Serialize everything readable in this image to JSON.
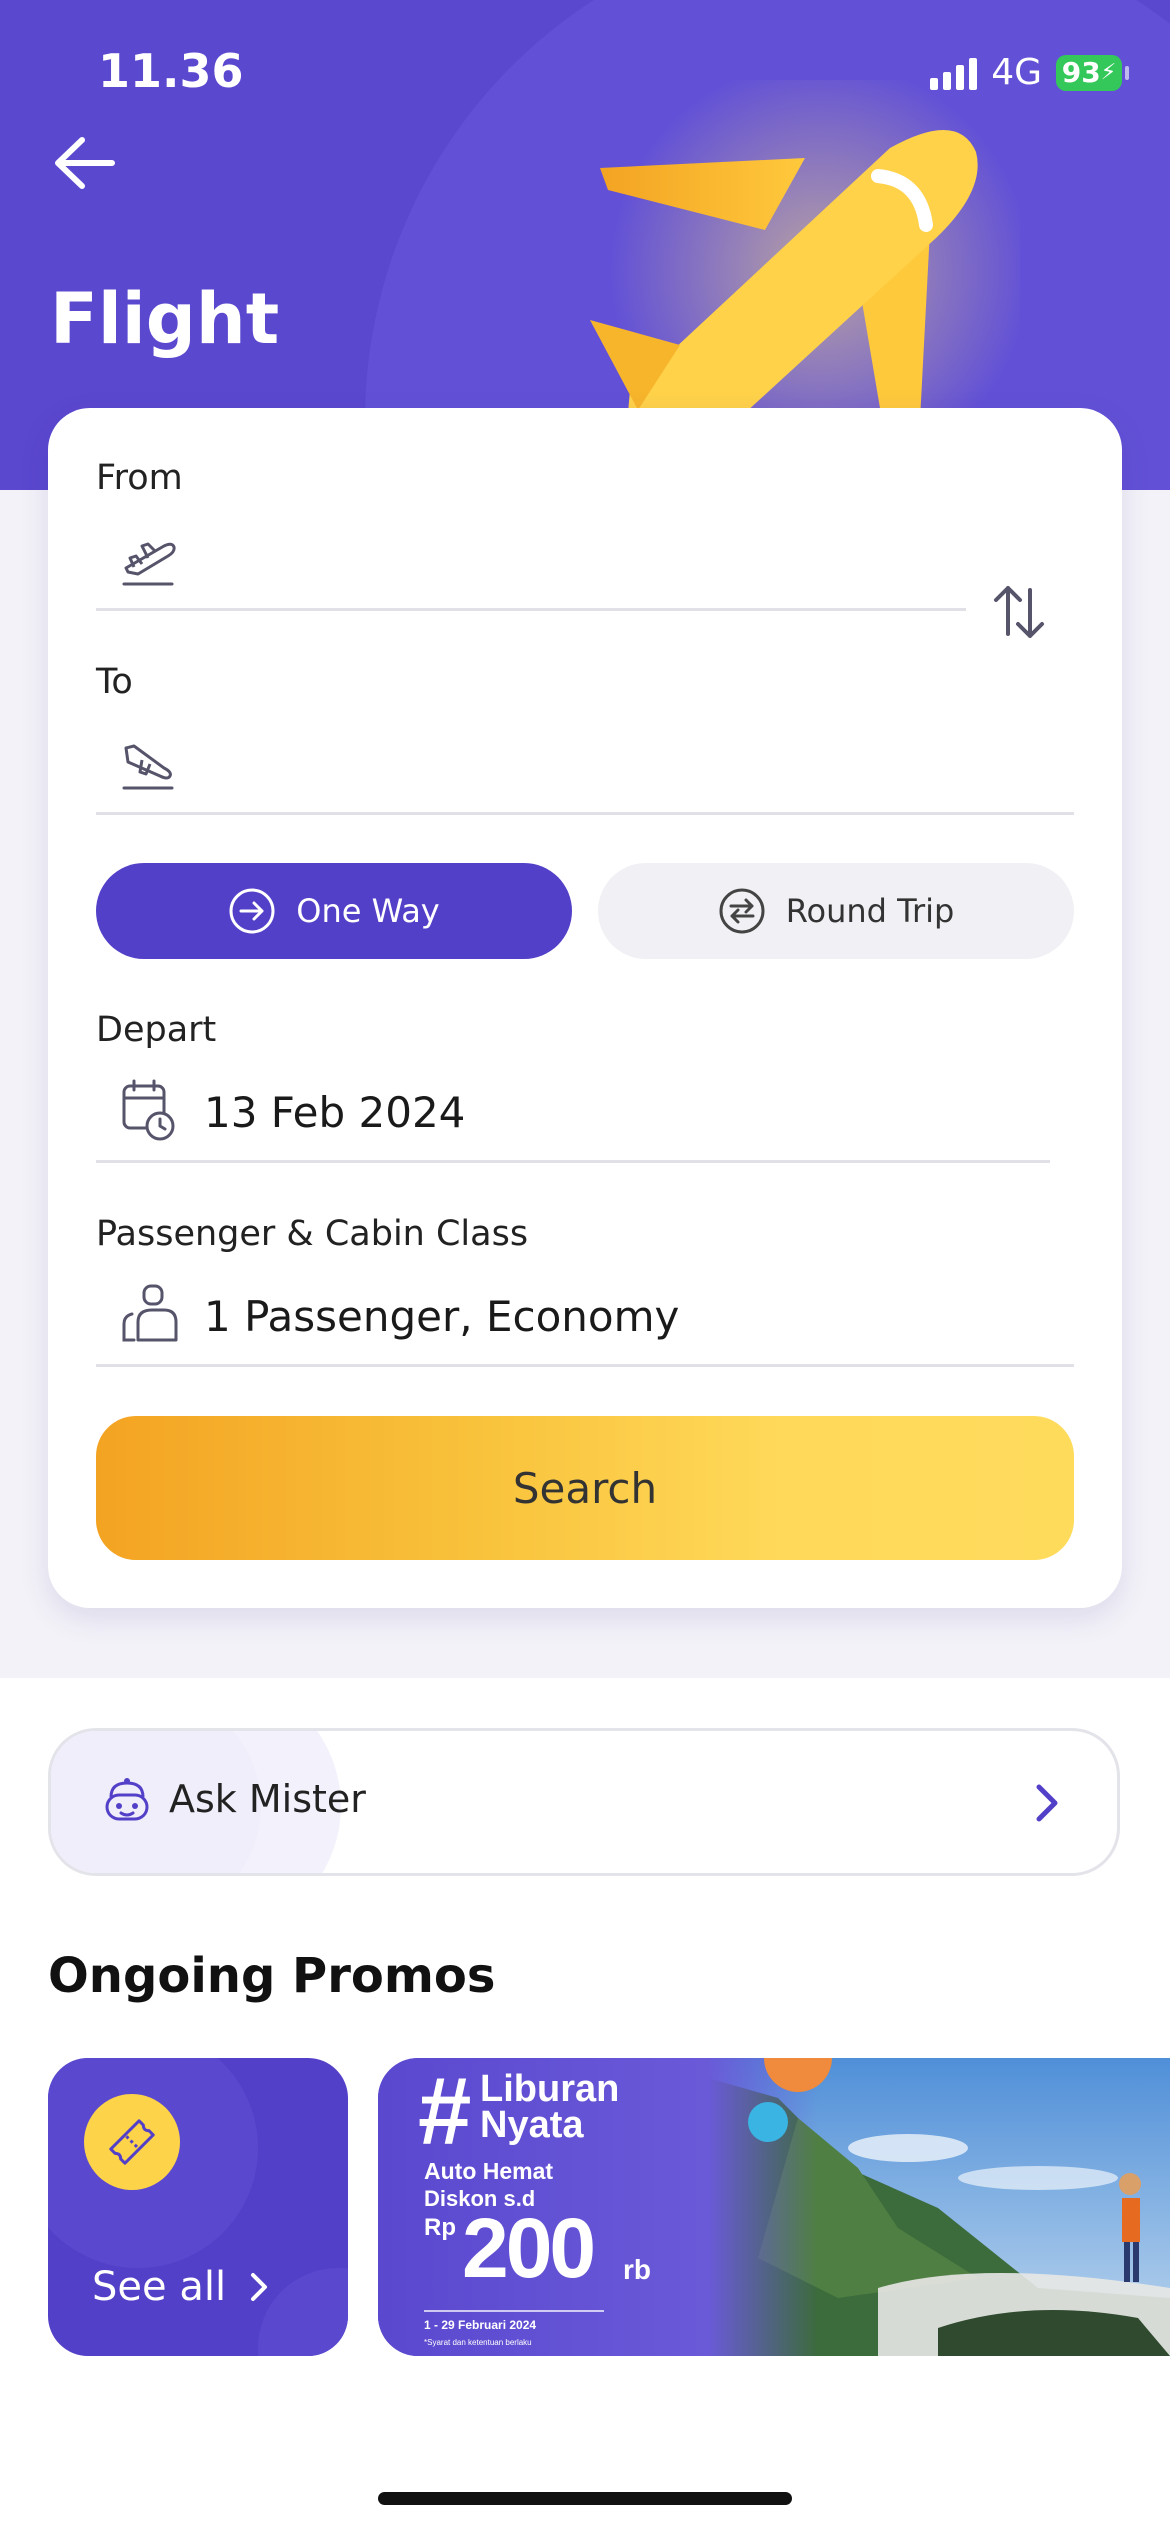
{
  "status_bar": {
    "time": "11.36",
    "network": "4G",
    "battery": "93"
  },
  "header": {
    "title": "Flight"
  },
  "form": {
    "from_label": "From",
    "from_value": "",
    "to_label": "To",
    "to_value": "",
    "trip_types": {
      "one_way": "One Way",
      "round_trip": "Round Trip",
      "selected": "One Way"
    },
    "depart_label": "Depart",
    "depart_value": "13 Feb 2024",
    "passenger_label": "Passenger & Cabin Class",
    "passenger_value": "1 Passenger, Economy",
    "search_label": "Search"
  },
  "ask_mister": {
    "label": "Ask Mister"
  },
  "promos": {
    "title": "Ongoing Promos",
    "see_all_label": "See all",
    "banner": {
      "hash": "#",
      "title_line1": "Liburan",
      "title_line2": "Nyata",
      "line1": "Auto Hemat",
      "line2": "Diskon s.d",
      "currency": "Rp",
      "amount": "200",
      "suffix": "rb",
      "date": "1 - 29 Februari 2024",
      "note": "*Syarat dan ketentuan berlaku"
    }
  },
  "colors": {
    "primary": "#5a48cf",
    "accent_yellow": "#fdd349",
    "search_start": "#f3a322",
    "search_end": "#ffdb5c"
  },
  "icons": [
    "back-arrow-icon",
    "airplane-illustration",
    "takeoff-icon",
    "landing-icon",
    "swap-icon",
    "one-way-icon",
    "round-trip-icon",
    "calendar-icon",
    "passenger-icon",
    "robot-icon",
    "chevron-right-icon",
    "ticket-icon"
  ]
}
